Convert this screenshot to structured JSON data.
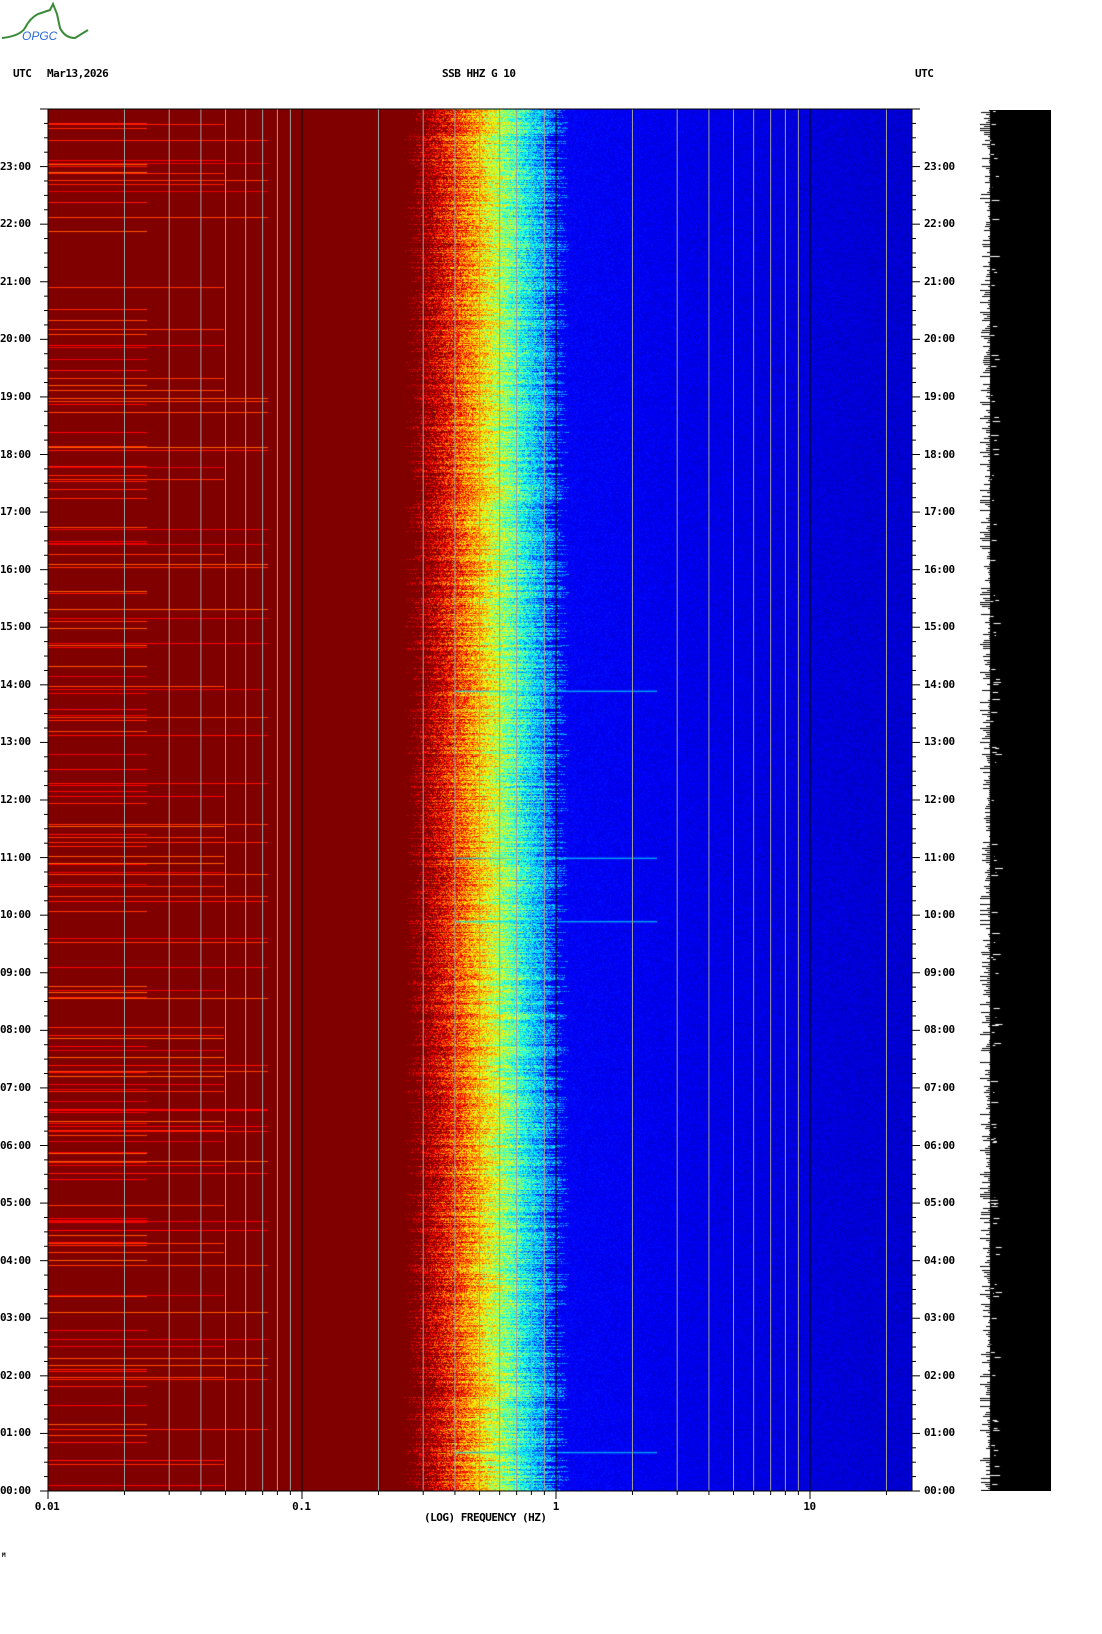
{
  "header": {
    "logo_text": "OPGC",
    "tz_left": "UTC",
    "date": "Mar13,2026",
    "station": "SSB HHZ G 10",
    "tz_right": "UTC"
  },
  "footer_mark": "M",
  "chart_data": {
    "type": "heatmap",
    "title": "SSB HHZ G 10",
    "xlabel": "(LOG) FREQUENCY (HZ)",
    "ylabel": "UTC",
    "xscale": "log",
    "xlim": [
      0.01,
      25
    ],
    "ylim_hours": [
      0,
      24
    ],
    "x_ticks": [
      {
        "value": 0.01,
        "label": "0.01"
      },
      {
        "value": 0.1,
        "label": "0.1"
      },
      {
        "value": 1,
        "label": "1"
      },
      {
        "value": 10,
        "label": "10"
      }
    ],
    "y_ticks": [
      "00:00",
      "01:00",
      "02:00",
      "03:00",
      "04:00",
      "05:00",
      "06:00",
      "07:00",
      "08:00",
      "09:00",
      "10:00",
      "11:00",
      "12:00",
      "13:00",
      "14:00",
      "15:00",
      "16:00",
      "17:00",
      "18:00",
      "19:00",
      "20:00",
      "21:00",
      "22:00",
      "23:00"
    ],
    "microseism_band_hz": [
      0.3,
      0.9
    ],
    "colors": {
      "low": "#800000",
      "high_freq_bg": "#0000a8",
      "peak": "#00ffff",
      "grid": "#a0a0a0"
    },
    "events_utc_hours": [
      0.68,
      13.9,
      11.0,
      9.9
    ]
  }
}
